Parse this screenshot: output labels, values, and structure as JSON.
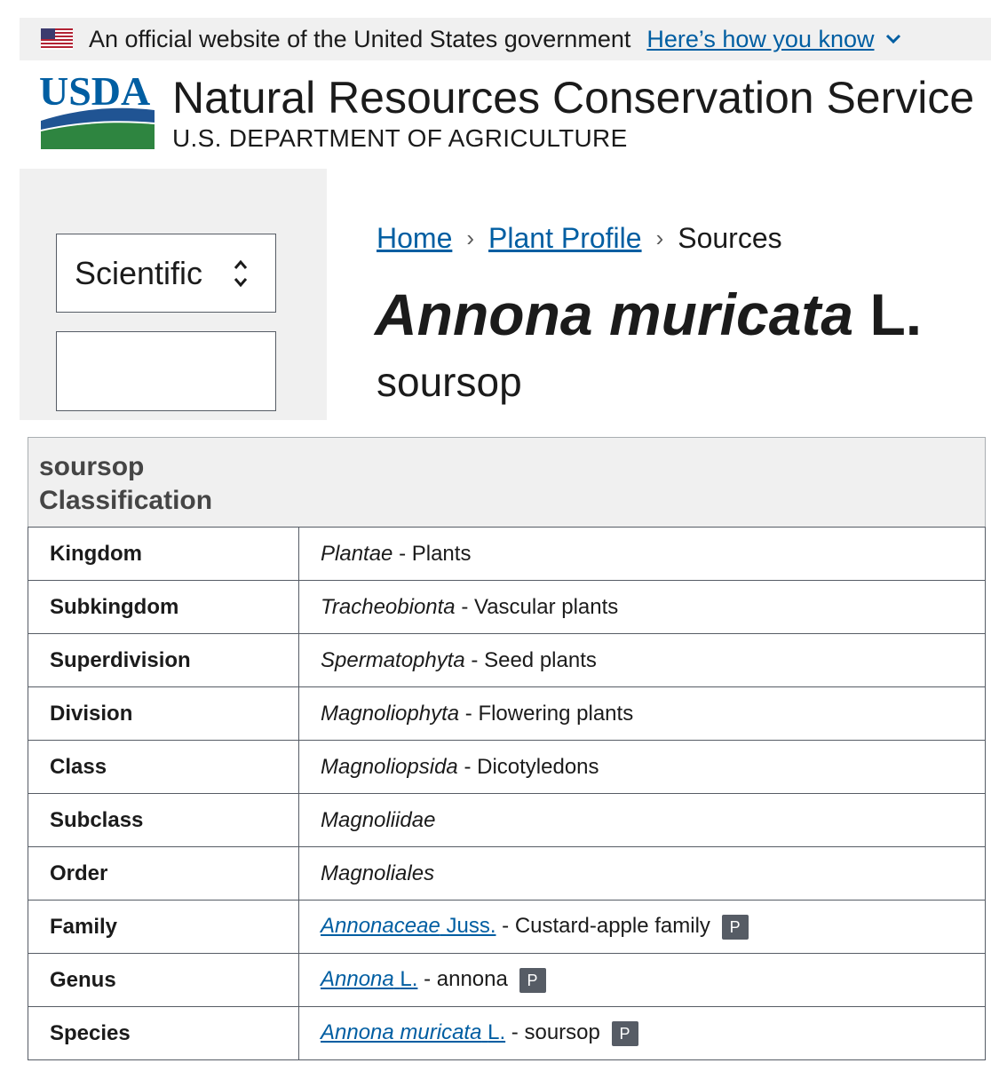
{
  "gov_banner": {
    "text": "An official website of the United States government",
    "link": "Here’s how you know"
  },
  "header": {
    "logo_text": "USDA",
    "agency": "Natural Resources Conservation Service",
    "department": "U.S. DEPARTMENT OF AGRICULTURE"
  },
  "sidebar": {
    "select_value": "Scientific",
    "search_value": ""
  },
  "breadcrumb": {
    "home": "Home",
    "profile": "Plant Profile",
    "current": "Sources"
  },
  "title": {
    "scientific": "Annona muricata",
    "author": "L.",
    "common": "soursop"
  },
  "classification": {
    "caption_line1": "soursop",
    "caption_line2": "Classification",
    "badge": "P",
    "rows": [
      {
        "rank": "Kingdom",
        "sci": "Plantae",
        "common": " - Plants"
      },
      {
        "rank": "Subkingdom",
        "sci": "Tracheobionta",
        "common": " - Vascular plants"
      },
      {
        "rank": "Superdivision",
        "sci": "Spermatophyta",
        "common": " - Seed plants"
      },
      {
        "rank": "Division",
        "sci": "Magnoliophyta",
        "common": " - Flowering plants"
      },
      {
        "rank": "Class",
        "sci": "Magnoliopsida",
        "common": " - Dicotyledons"
      },
      {
        "rank": "Subclass",
        "sci": "Magnoliidae",
        "common": ""
      },
      {
        "rank": "Order",
        "sci": "Magnoliales",
        "common": ""
      },
      {
        "rank": "Family",
        "sci": "Annonaceae",
        "author": "Juss.",
        "common": " - Custard-apple family"
      },
      {
        "rank": "Genus",
        "sci": "Annona",
        "author": "L.",
        "common": " - annona"
      },
      {
        "rank": "Species",
        "sci": "Annona muricata",
        "author": "L.",
        "common": " - soursop"
      }
    ]
  }
}
